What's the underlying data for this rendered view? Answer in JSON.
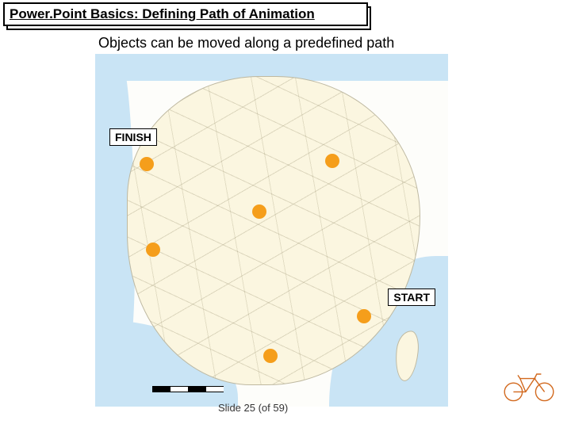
{
  "title": "Power.Point Basics: Defining Path of Animation",
  "subtitle": "Objects can be moved along a predefined path",
  "labels": {
    "finish": "FINISH",
    "start": "START"
  },
  "footer": {
    "slide_text": "Slide  25 (of  59)"
  }
}
